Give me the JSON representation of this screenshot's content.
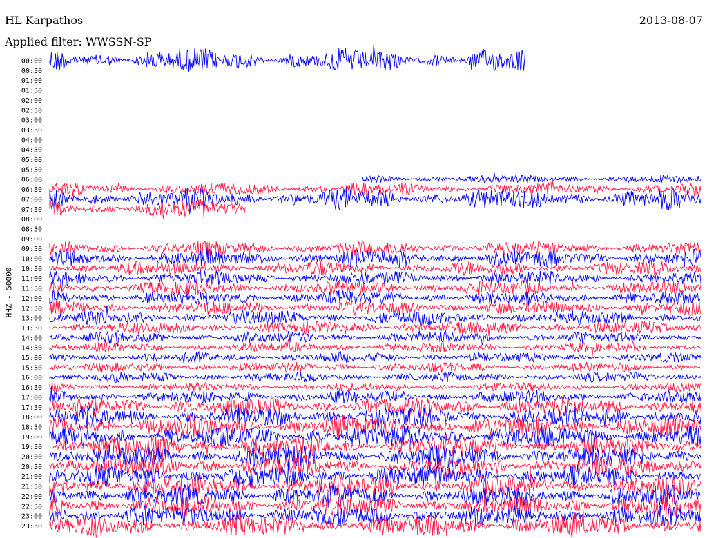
{
  "header": {
    "station": "HL Karpathos",
    "date": "2013-08-07",
    "filter": "Applied filter: WWSSN-SP"
  },
  "chart_data": {
    "type": "line",
    "title": "HL Karpathos",
    "subtitle": "Applied filter: WWSSN-SP",
    "date": "2013-08-07",
    "ylabel": "HHZ - 50000",
    "row_labels": [
      "00:00",
      "00:30",
      "01:00",
      "01:30",
      "02:00",
      "02:30",
      "03:00",
      "03:30",
      "04:00",
      "04:30",
      "05:00",
      "05:30",
      "06:00",
      "06:30",
      "07:00",
      "07:30",
      "08:00",
      "08:30",
      "09:00",
      "09:30",
      "10:00",
      "10:30",
      "11:00",
      "11:30",
      "12:00",
      "12:30",
      "13:00",
      "13:30",
      "14:00",
      "14:30",
      "15:00",
      "15:30",
      "16:00",
      "16:30",
      "17:00",
      "17:30",
      "18:00",
      "18:30",
      "19:00",
      "19:30",
      "20:00",
      "20:30",
      "21:00",
      "21:30",
      "22:00",
      "22:30",
      "23:00",
      "23:30"
    ],
    "series_colors": [
      "#0000ff",
      "#ff1744"
    ],
    "minutes_per_row": 30,
    "rows": [
      {
        "label": "00:00",
        "start": 0,
        "end": 0.73,
        "amp": 16
      },
      {
        "label": "06:00",
        "start": 0.48,
        "end": 1,
        "amp": 6
      },
      {
        "label": "06:30",
        "start": 0,
        "end": 1,
        "amp": 9
      },
      {
        "label": "07:00",
        "start": 0,
        "end": 1,
        "amp": 14
      },
      {
        "label": "07:30",
        "start": 0,
        "end": 0.3,
        "amp": 12
      },
      {
        "label": "09:30",
        "start": 0,
        "end": 1,
        "amp": 10
      },
      {
        "label": "10:00",
        "start": 0,
        "end": 1,
        "amp": 12
      },
      {
        "label": "10:30",
        "start": 0,
        "end": 1,
        "amp": 10
      },
      {
        "label": "11:00",
        "start": 0,
        "end": 1,
        "amp": 10
      },
      {
        "label": "11:30",
        "start": 0,
        "end": 1,
        "amp": 10
      },
      {
        "label": "12:00",
        "start": 0,
        "end": 1,
        "amp": 10
      },
      {
        "label": "12:30",
        "start": 0,
        "end": 1,
        "amp": 10
      },
      {
        "label": "13:00",
        "start": 0,
        "end": 1,
        "amp": 10
      },
      {
        "label": "13:30",
        "start": 0,
        "end": 1,
        "amp": 9
      },
      {
        "label": "14:00",
        "start": 0,
        "end": 1,
        "amp": 8
      },
      {
        "label": "14:30",
        "start": 0,
        "end": 1,
        "amp": 7
      },
      {
        "label": "15:00",
        "start": 0,
        "end": 1,
        "amp": 7
      },
      {
        "label": "15:30",
        "start": 0,
        "end": 1,
        "amp": 7
      },
      {
        "label": "16:00",
        "start": 0,
        "end": 1,
        "amp": 7
      },
      {
        "label": "16:30",
        "start": 0,
        "end": 1,
        "amp": 6
      },
      {
        "label": "17:00",
        "start": 0,
        "end": 1,
        "amp": 9
      },
      {
        "label": "17:30",
        "start": 0,
        "end": 1,
        "amp": 13
      },
      {
        "label": "18:00",
        "start": 0,
        "end": 1,
        "amp": 14
      },
      {
        "label": "18:30",
        "start": 0,
        "end": 1,
        "amp": 15
      },
      {
        "label": "19:00",
        "start": 0,
        "end": 1,
        "amp": 15
      },
      {
        "label": "19:30",
        "start": 0,
        "end": 1,
        "amp": 15
      },
      {
        "label": "20:00",
        "start": 0,
        "end": 1,
        "amp": 15
      },
      {
        "label": "20:30",
        "start": 0,
        "end": 1,
        "amp": 15
      },
      {
        "label": "21:00",
        "start": 0,
        "end": 1,
        "amp": 15
      },
      {
        "label": "21:30",
        "start": 0,
        "end": 1,
        "amp": 15
      },
      {
        "label": "22:00",
        "start": 0,
        "end": 1,
        "amp": 15
      },
      {
        "label": "22:30",
        "start": 0,
        "end": 1,
        "amp": 15
      },
      {
        "label": "23:00",
        "start": 0,
        "end": 1,
        "amp": 15
      },
      {
        "label": "23:30",
        "start": 0,
        "end": 1,
        "amp": 15
      }
    ]
  }
}
